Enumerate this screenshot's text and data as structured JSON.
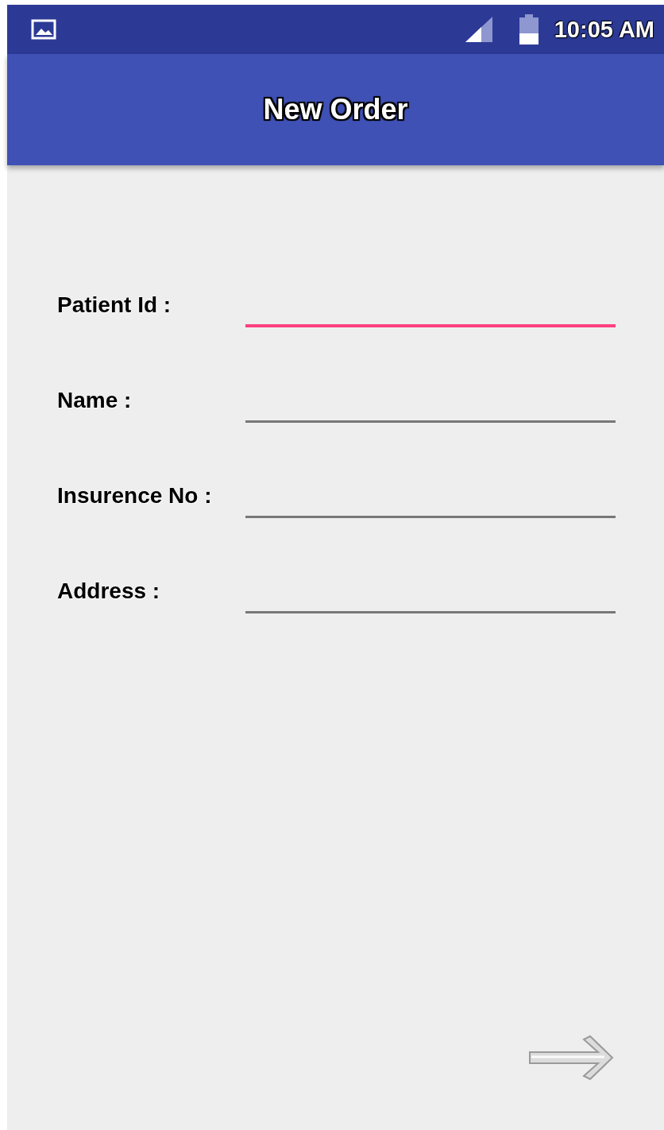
{
  "status_bar": {
    "time": "10:05 AM"
  },
  "app_bar": {
    "title": "New Order"
  },
  "fields": [
    {
      "label": "Patient Id :",
      "focused": true
    },
    {
      "label": "Name :",
      "focused": false
    },
    {
      "label": "Insurence No :",
      "focused": false
    },
    {
      "label": "Address :",
      "focused": false
    }
  ]
}
